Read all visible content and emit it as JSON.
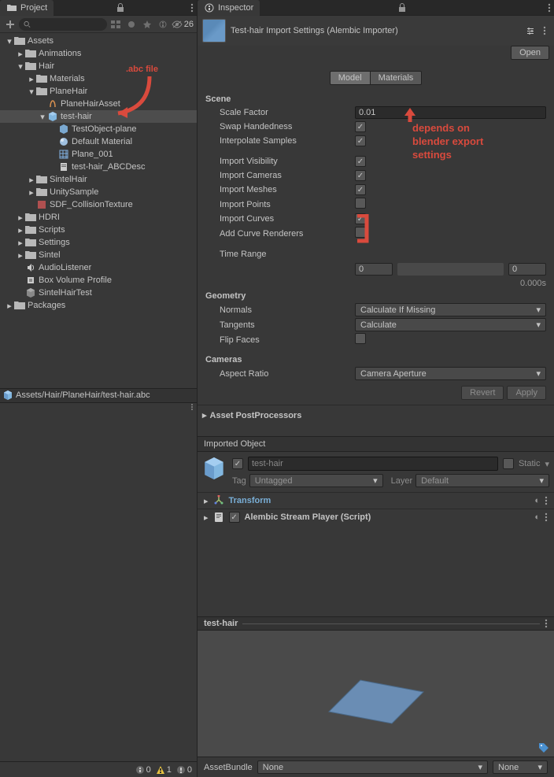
{
  "project": {
    "tab_label": "Project",
    "toolbar": {
      "search_placeholder": "",
      "visible_count": "26"
    },
    "tree": [
      {
        "indent": 0,
        "fold": "open",
        "icon": "folder",
        "label": "Assets",
        "selected": false
      },
      {
        "indent": 1,
        "fold": "closed",
        "icon": "folder",
        "label": "Animations",
        "selected": false
      },
      {
        "indent": 1,
        "fold": "open",
        "icon": "folder",
        "label": "Hair",
        "selected": false
      },
      {
        "indent": 2,
        "fold": "closed",
        "icon": "folder",
        "label": "Materials",
        "selected": false
      },
      {
        "indent": 2,
        "fold": "open",
        "icon": "folder",
        "label": "PlaneHair",
        "selected": false
      },
      {
        "indent": 3,
        "fold": "none",
        "icon": "hair-asset",
        "label": "PlaneHairAsset",
        "selected": false
      },
      {
        "indent": 3,
        "fold": "open",
        "icon": "cube",
        "label": "test-hair",
        "selected": true
      },
      {
        "indent": 4,
        "fold": "none",
        "icon": "prefab",
        "label": "TestObject-plane",
        "selected": false
      },
      {
        "indent": 4,
        "fold": "none",
        "icon": "material",
        "label": "Default Material",
        "selected": false
      },
      {
        "indent": 4,
        "fold": "none",
        "icon": "mesh",
        "label": "Plane_001",
        "selected": false
      },
      {
        "indent": 4,
        "fold": "none",
        "icon": "script",
        "label": "test-hair_ABCDesc",
        "selected": false
      },
      {
        "indent": 2,
        "fold": "closed",
        "icon": "folder",
        "label": "SintelHair",
        "selected": false
      },
      {
        "indent": 2,
        "fold": "closed",
        "icon": "folder",
        "label": "UnitySample",
        "selected": false
      },
      {
        "indent": 2,
        "fold": "none",
        "icon": "texture",
        "label": "SDF_CollisionTexture",
        "selected": false
      },
      {
        "indent": 1,
        "fold": "closed",
        "icon": "folder",
        "label": "HDRI",
        "selected": false
      },
      {
        "indent": 1,
        "fold": "closed",
        "icon": "folder",
        "label": "Scripts",
        "selected": false
      },
      {
        "indent": 1,
        "fold": "closed",
        "icon": "folder",
        "label": "Settings",
        "selected": false
      },
      {
        "indent": 1,
        "fold": "closed",
        "icon": "folder",
        "label": "Sintel",
        "selected": false
      },
      {
        "indent": 1,
        "fold": "none",
        "icon": "audio",
        "label": "AudioListener",
        "selected": false
      },
      {
        "indent": 1,
        "fold": "none",
        "icon": "volume",
        "label": "Box Volume Profile",
        "selected": false
      },
      {
        "indent": 1,
        "fold": "none",
        "icon": "scene",
        "label": "SintelHairTest",
        "selected": false
      },
      {
        "indent": 0,
        "fold": "closed",
        "icon": "folder",
        "label": "Packages",
        "selected": false
      }
    ],
    "path": "Assets/Hair/PlaneHair/test-hair.abc",
    "status": {
      "info": "0",
      "warn": "1",
      "err": "0"
    }
  },
  "inspector": {
    "tab_label": "Inspector",
    "title": "Test-hair Import Settings (Alembic Importer)",
    "open_btn": "Open",
    "tabs": {
      "model": "Model",
      "materials": "Materials",
      "active": "model"
    },
    "sections": {
      "scene": {
        "heading": "Scene",
        "scale_factor_label": "Scale Factor",
        "scale_factor_value": "0.01",
        "swap_handedness_label": "Swap Handedness",
        "swap_handedness_value": true,
        "interpolate_samples_label": "Interpolate Samples",
        "interpolate_samples_value": true,
        "import_visibility_label": "Import Visibility",
        "import_visibility_value": true,
        "import_cameras_label": "Import Cameras",
        "import_cameras_value": true,
        "import_meshes_label": "Import Meshes",
        "import_meshes_value": true,
        "import_points_label": "Import Points",
        "import_points_value": false,
        "import_curves_label": "Import Curves",
        "import_curves_value": true,
        "add_curve_renderers_label": "Add Curve Renderers",
        "add_curve_renderers_value": false,
        "time_range_label": "Time Range",
        "time_range_from": "0",
        "time_range_to": "0",
        "time_readout": "0.000s"
      },
      "geometry": {
        "heading": "Geometry",
        "normals_label": "Normals",
        "normals_value": "Calculate If Missing",
        "tangents_label": "Tangents",
        "tangents_value": "Calculate",
        "flip_faces_label": "Flip Faces",
        "flip_faces_value": false
      },
      "cameras": {
        "heading": "Cameras",
        "aspect_ratio_label": "Aspect Ratio",
        "aspect_ratio_value": "Camera Aperture"
      }
    },
    "revert_btn": "Revert",
    "apply_btn": "Apply",
    "asset_postprocessors": "Asset PostProcessors",
    "imported_object_label": "Imported Object",
    "imported": {
      "name": "test-hair",
      "enabled": true,
      "static_label": "Static",
      "static_value": false,
      "tag_label": "Tag",
      "tag_value": "Untagged",
      "layer_label": "Layer",
      "layer_value": "Default"
    },
    "components": {
      "transform": "Transform",
      "alembic": "Alembic Stream Player (Script)"
    },
    "preview_title": "test-hair",
    "bundle": {
      "label": "AssetBundle",
      "name_value": "None",
      "variant_value": "None"
    }
  },
  "annotations": {
    "abc_file": ".abc file",
    "depends_on": "depends on blender export settings"
  }
}
